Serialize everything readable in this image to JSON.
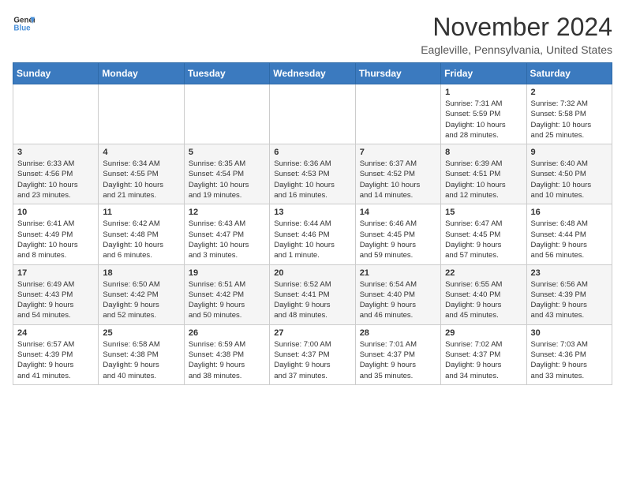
{
  "header": {
    "logo_general": "General",
    "logo_blue": "Blue",
    "month_title": "November 2024",
    "location": "Eagleville, Pennsylvania, United States"
  },
  "weekdays": [
    "Sunday",
    "Monday",
    "Tuesday",
    "Wednesday",
    "Thursday",
    "Friday",
    "Saturday"
  ],
  "weeks": [
    [
      {
        "day": "",
        "info": ""
      },
      {
        "day": "",
        "info": ""
      },
      {
        "day": "",
        "info": ""
      },
      {
        "day": "",
        "info": ""
      },
      {
        "day": "",
        "info": ""
      },
      {
        "day": "1",
        "info": "Sunrise: 7:31 AM\nSunset: 5:59 PM\nDaylight: 10 hours\nand 28 minutes."
      },
      {
        "day": "2",
        "info": "Sunrise: 7:32 AM\nSunset: 5:58 PM\nDaylight: 10 hours\nand 25 minutes."
      }
    ],
    [
      {
        "day": "3",
        "info": "Sunrise: 6:33 AM\nSunset: 4:56 PM\nDaylight: 10 hours\nand 23 minutes."
      },
      {
        "day": "4",
        "info": "Sunrise: 6:34 AM\nSunset: 4:55 PM\nDaylight: 10 hours\nand 21 minutes."
      },
      {
        "day": "5",
        "info": "Sunrise: 6:35 AM\nSunset: 4:54 PM\nDaylight: 10 hours\nand 19 minutes."
      },
      {
        "day": "6",
        "info": "Sunrise: 6:36 AM\nSunset: 4:53 PM\nDaylight: 10 hours\nand 16 minutes."
      },
      {
        "day": "7",
        "info": "Sunrise: 6:37 AM\nSunset: 4:52 PM\nDaylight: 10 hours\nand 14 minutes."
      },
      {
        "day": "8",
        "info": "Sunrise: 6:39 AM\nSunset: 4:51 PM\nDaylight: 10 hours\nand 12 minutes."
      },
      {
        "day": "9",
        "info": "Sunrise: 6:40 AM\nSunset: 4:50 PM\nDaylight: 10 hours\nand 10 minutes."
      }
    ],
    [
      {
        "day": "10",
        "info": "Sunrise: 6:41 AM\nSunset: 4:49 PM\nDaylight: 10 hours\nand 8 minutes."
      },
      {
        "day": "11",
        "info": "Sunrise: 6:42 AM\nSunset: 4:48 PM\nDaylight: 10 hours\nand 6 minutes."
      },
      {
        "day": "12",
        "info": "Sunrise: 6:43 AM\nSunset: 4:47 PM\nDaylight: 10 hours\nand 3 minutes."
      },
      {
        "day": "13",
        "info": "Sunrise: 6:44 AM\nSunset: 4:46 PM\nDaylight: 10 hours\nand 1 minute."
      },
      {
        "day": "14",
        "info": "Sunrise: 6:46 AM\nSunset: 4:45 PM\nDaylight: 9 hours\nand 59 minutes."
      },
      {
        "day": "15",
        "info": "Sunrise: 6:47 AM\nSunset: 4:45 PM\nDaylight: 9 hours\nand 57 minutes."
      },
      {
        "day": "16",
        "info": "Sunrise: 6:48 AM\nSunset: 4:44 PM\nDaylight: 9 hours\nand 56 minutes."
      }
    ],
    [
      {
        "day": "17",
        "info": "Sunrise: 6:49 AM\nSunset: 4:43 PM\nDaylight: 9 hours\nand 54 minutes."
      },
      {
        "day": "18",
        "info": "Sunrise: 6:50 AM\nSunset: 4:42 PM\nDaylight: 9 hours\nand 52 minutes."
      },
      {
        "day": "19",
        "info": "Sunrise: 6:51 AM\nSunset: 4:42 PM\nDaylight: 9 hours\nand 50 minutes."
      },
      {
        "day": "20",
        "info": "Sunrise: 6:52 AM\nSunset: 4:41 PM\nDaylight: 9 hours\nand 48 minutes."
      },
      {
        "day": "21",
        "info": "Sunrise: 6:54 AM\nSunset: 4:40 PM\nDaylight: 9 hours\nand 46 minutes."
      },
      {
        "day": "22",
        "info": "Sunrise: 6:55 AM\nSunset: 4:40 PM\nDaylight: 9 hours\nand 45 minutes."
      },
      {
        "day": "23",
        "info": "Sunrise: 6:56 AM\nSunset: 4:39 PM\nDaylight: 9 hours\nand 43 minutes."
      }
    ],
    [
      {
        "day": "24",
        "info": "Sunrise: 6:57 AM\nSunset: 4:39 PM\nDaylight: 9 hours\nand 41 minutes."
      },
      {
        "day": "25",
        "info": "Sunrise: 6:58 AM\nSunset: 4:38 PM\nDaylight: 9 hours\nand 40 minutes."
      },
      {
        "day": "26",
        "info": "Sunrise: 6:59 AM\nSunset: 4:38 PM\nDaylight: 9 hours\nand 38 minutes."
      },
      {
        "day": "27",
        "info": "Sunrise: 7:00 AM\nSunset: 4:37 PM\nDaylight: 9 hours\nand 37 minutes."
      },
      {
        "day": "28",
        "info": "Sunrise: 7:01 AM\nSunset: 4:37 PM\nDaylight: 9 hours\nand 35 minutes."
      },
      {
        "day": "29",
        "info": "Sunrise: 7:02 AM\nSunset: 4:37 PM\nDaylight: 9 hours\nand 34 minutes."
      },
      {
        "day": "30",
        "info": "Sunrise: 7:03 AM\nSunset: 4:36 PM\nDaylight: 9 hours\nand 33 minutes."
      }
    ]
  ]
}
